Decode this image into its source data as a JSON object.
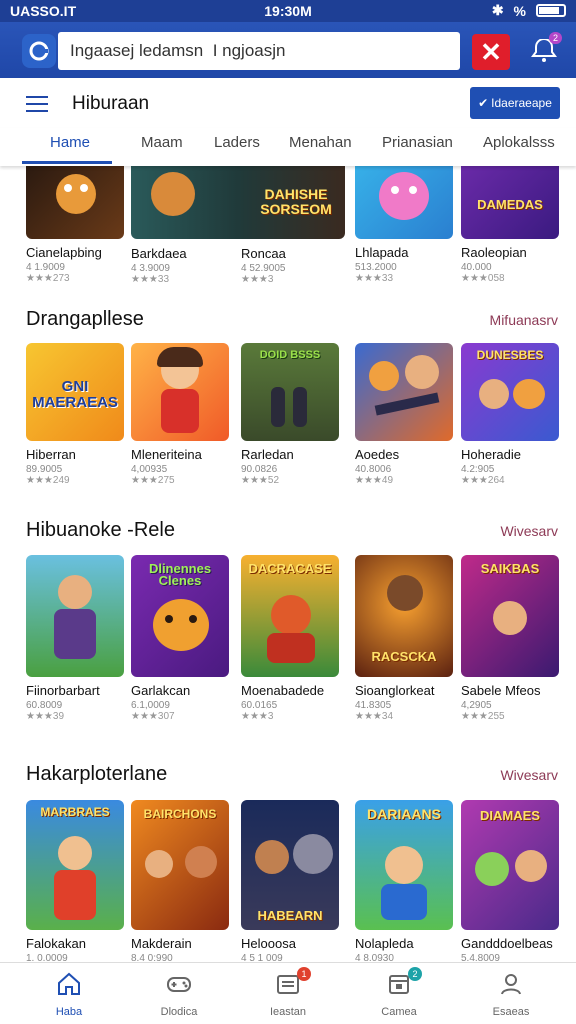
{
  "status": {
    "carrier": "UASSO.IT",
    "time": "19:30M",
    "bluetooth": "✱",
    "percent": "%"
  },
  "search": {
    "value": "Ingaasej ledamsn  I ngjoasjn",
    "close": "✕",
    "notif_badge": "2"
  },
  "header": {
    "title": "Hiburaan",
    "action_label": "Idaeraeape",
    "action_check": "✔"
  },
  "tabs": [
    "Hame",
    "Maam",
    "Laders",
    "Menahan",
    "Prianasian",
    "Aplokalsss"
  ],
  "sections": [
    {
      "title": "",
      "more": "",
      "items": [
        {
          "name": "Cianelapbing",
          "meta": "4 1.9009",
          "stars": "★★★273",
          "tag": ""
        },
        {
          "name": "Barkdaea",
          "meta": "4 3.9009",
          "stars": "★★★33",
          "tag": ""
        },
        {
          "name": "Roncaa",
          "meta": "4 52.9005",
          "stars": "★★★3",
          "tag": "DAHISHE SORSEOM"
        },
        {
          "name": "Lhlapada",
          "meta": "513.2000",
          "stars": "★★★33",
          "tag": ""
        },
        {
          "name": "Raoleopian",
          "meta": "40.000",
          "stars": "★★★058",
          "tag": "DAMEDAS"
        }
      ]
    },
    {
      "title": "Drangapllese",
      "more": "Mifuanasrv",
      "items": [
        {
          "name": "Hiberran",
          "meta": "89.9005",
          "stars": "★★★249",
          "tag": "GNI MAERAEAS"
        },
        {
          "name": "Mleneriteina",
          "meta": "4,00935",
          "stars": "★★★275",
          "tag": ""
        },
        {
          "name": "Rarledan",
          "meta": "90.0826",
          "stars": "★★★52",
          "tag": "DOID BSSS"
        },
        {
          "name": "Aoedes",
          "meta": "40.8006",
          "stars": "★★★49",
          "tag": ""
        },
        {
          "name": "Hoheradie",
          "meta": "4.2:905",
          "stars": "★★★264",
          "tag": "DUNESBES"
        }
      ]
    },
    {
      "title": "Hibuanoke -Rele",
      "more": "Wivesarv",
      "items": [
        {
          "name": "Fiinorbarbart",
          "meta": "60.8009",
          "stars": "★★★39",
          "tag": ""
        },
        {
          "name": "Garlakcan",
          "meta": "6.1,0009",
          "stars": "★★★307",
          "tag": "Dlinennes Clenes"
        },
        {
          "name": "Moenabadede",
          "meta": "60.0165",
          "stars": "★★★3",
          "tag": "DACRACASE"
        },
        {
          "name": "Sioanglorkeat",
          "meta": "41.8305",
          "stars": "★★★34",
          "tag": "RACSCKA"
        },
        {
          "name": "Sabele Mfeos",
          "meta": "4,2905",
          "stars": "★★★255",
          "tag": "SAIKBAS"
        }
      ]
    },
    {
      "title": "Hakarploterlane",
      "more": "Wivesarv",
      "items": [
        {
          "name": "Falokakan",
          "meta": "1. 0.0009",
          "stars": "",
          "tag": "MARBRAES"
        },
        {
          "name": "Makderain",
          "meta": "8.4 0:990",
          "stars": "",
          "tag": "BAIRCHONS"
        },
        {
          "name": "Helooosa",
          "meta": "4 5 1 009",
          "stars": "",
          "tag": "HABEARN"
        },
        {
          "name": "Nolapleda",
          "meta": "4 8.0930",
          "stars": "",
          "tag": "DARIAANS"
        },
        {
          "name": "Gandddoelbeas",
          "meta": "5.4.8009",
          "stars": "",
          "tag": "DIAMAES"
        }
      ]
    }
  ],
  "nav": [
    {
      "label": "Haba",
      "icon": "home-icon",
      "badge": ""
    },
    {
      "label": "Dlodica",
      "icon": "gamepad-icon",
      "badge": ""
    },
    {
      "label": "Ieastan",
      "icon": "inbox-icon",
      "badge": "1"
    },
    {
      "label": "Camea",
      "icon": "calendar-icon",
      "badge": "2"
    },
    {
      "label": "Esaeas",
      "icon": "profile-icon",
      "badge": ""
    }
  ],
  "colors": {
    "primary": "#1f4fb3",
    "close": "#e01e2b",
    "more_link": "#8d3a56",
    "badge_red": "#e0412e",
    "badge_teal": "#1da3a8"
  }
}
